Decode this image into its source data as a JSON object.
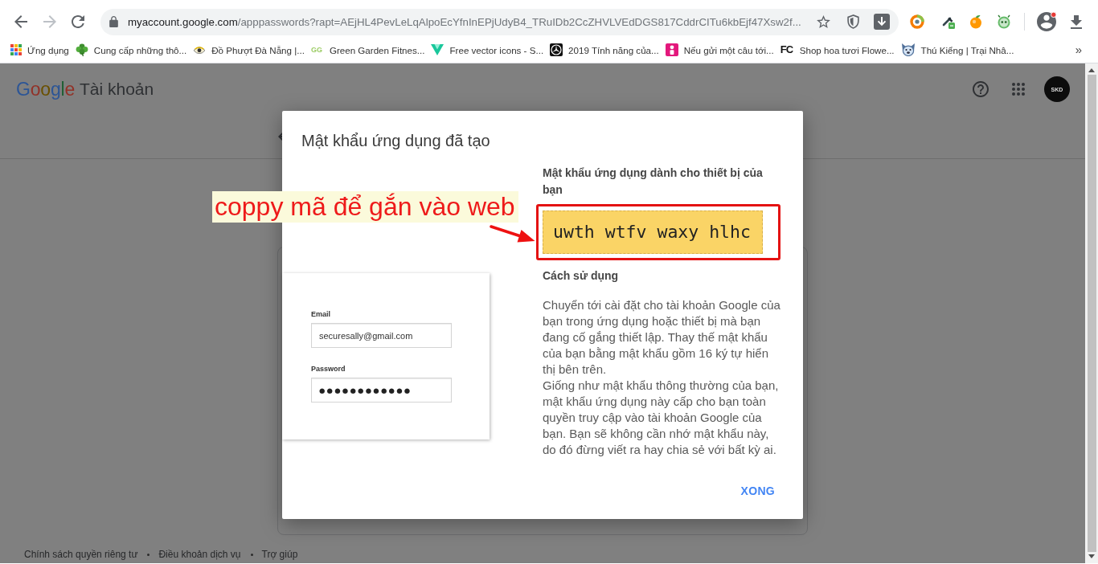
{
  "browser": {
    "nav_buttons": [
      {
        "kind": "back",
        "disabled": false
      },
      {
        "kind": "forward",
        "disabled": true
      },
      {
        "kind": "reload",
        "disabled": false
      }
    ],
    "address_bar": {
      "host": "myaccount.google.com",
      "path": "/apppasswords?rapt=AEjHL4PevLeLqAlpoEcYfnInEPjUdyB4_TRuIDb2CcZHVLVEdDGS817CddrCITu6kbEjf47Xsw2f..."
    },
    "profile": {
      "notification": true
    },
    "bookmarks": [
      {
        "kind": "apps",
        "label": "Ứng dụng"
      },
      {
        "kind": "clover",
        "label": "Cung cấp những thô..."
      },
      {
        "kind": "eye",
        "label": "Đồ Phượt Đà Nẵng |..."
      },
      {
        "kind": "tinytext",
        "favicon": "GG",
        "label": "Green Garden Fitnes..."
      },
      {
        "kind": "chevron",
        "label": "Free vector icons - S..."
      },
      {
        "kind": "emblem",
        "label": "2019 Tính năng của..."
      },
      {
        "kind": "tile",
        "label": "Nếu gửi một câu tới..."
      },
      {
        "kind": "monogram",
        "favicon": "FC",
        "label": "Shop hoa tươi Flowe..."
      },
      {
        "kind": "animal",
        "label": "Thú Kiểng | Trại Nhâ..."
      }
    ],
    "bookmarks_overflow": "»"
  },
  "page": {
    "header": {
      "logo": "Google",
      "product": "Tài khoản",
      "avatar_initials": "SKD"
    },
    "footer_links": [
      "Chính sách quyền riêng tư",
      "Điều khoản dịch vụ",
      "Trợ giúp"
    ]
  },
  "dialog": {
    "title": "Mật khẩu ứng dụng đã tạo",
    "illustration": {
      "email_label": "Email",
      "email_value": "securesally@gmail.com",
      "password_label": "Password",
      "password_value": "●●●●●●●●●●●●"
    },
    "password_heading": "Mật khẩu ứng dụng dành cho thiết bị của bạn",
    "app_password": "uwth wtfv waxy hlhc",
    "usage_heading": "Cách sử dụng",
    "usage_paragraphs": [
      "Chuyển tới cài đặt cho tài khoản Google của bạn trong ứng dụng hoặc thiết bị mà bạn đang cố gắng thiết lập. Thay thế mật khẩu của bạn bằng mật khẩu gồm 16 ký tự hiển thị bên trên.",
      "Giống như mật khẩu thông thường của bạn, mật khẩu ứng dụng này cấp cho bạn toàn quyền truy cập vào tài khoản Google của bạn. Bạn sẽ không cần nhớ mật khẩu này, do đó đừng viết ra hay chia sẻ với bất kỳ ai."
    ],
    "done_button": "XONG"
  },
  "annotation": {
    "text": "coppy mã để gắn vào web"
  }
}
